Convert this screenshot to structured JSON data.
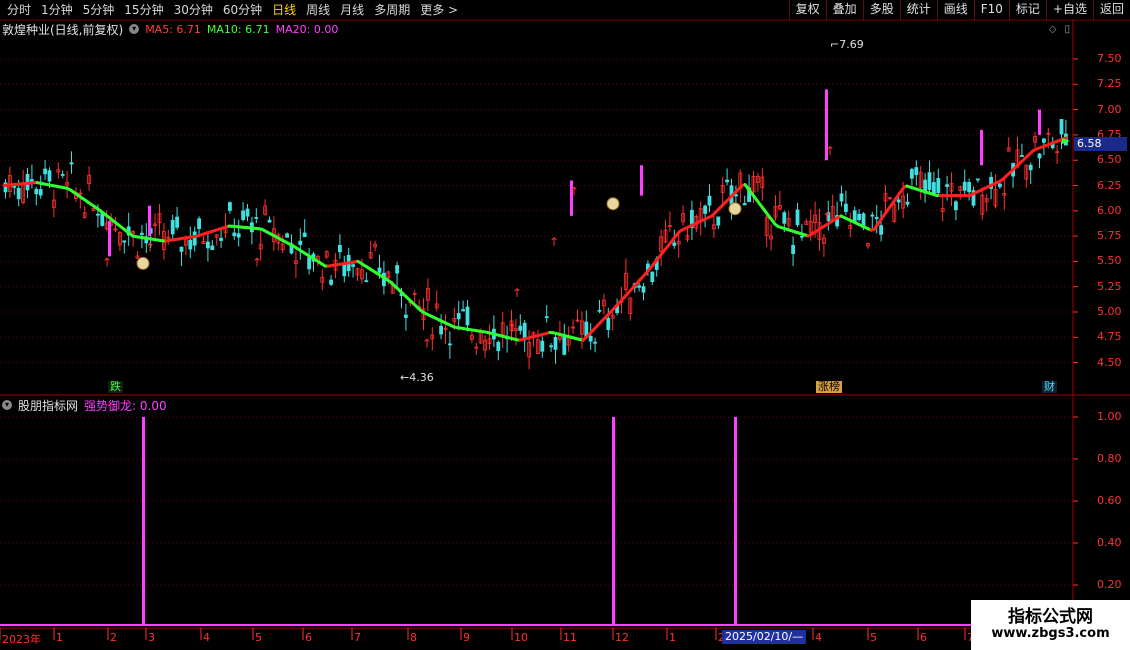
{
  "toolbar": {
    "periods": [
      "分时",
      "1分钟",
      "5分钟",
      "15分钟",
      "30分钟",
      "60分钟",
      "日线",
      "周线",
      "月线",
      "多周期",
      "更多 >"
    ],
    "active_period": "日线",
    "right_buttons": [
      "复权",
      "叠加",
      "多股",
      "统计",
      "画线",
      "F10",
      "标记",
      "+自选",
      "返回"
    ]
  },
  "main_header": {
    "stock_title": "敦煌种业(日线,前复权)",
    "ma5": "MA5: 6.71",
    "ma10": "MA10: 6.71",
    "ma20": "MA20: 0.00"
  },
  "indicator_header": {
    "name": "股朋指标网",
    "var": "强势御龙: 0.00"
  },
  "colors": {
    "axis": "#ff3030",
    "grid": "#6a0000",
    "up": "#ff3030",
    "down": "#40e0e0",
    "ma_up": "#ff2020",
    "ma_down": "#30ff30",
    "signal": "#ff40ff",
    "price_box": "#1a2a8a"
  },
  "price_axis": [
    "7.50",
    "7.25",
    "7.00",
    "6.75",
    "6.50",
    "6.25",
    "6.00",
    "5.75",
    "5.50",
    "5.25",
    "5.00",
    "4.75",
    "4.50"
  ],
  "indicator_axis": [
    "1.00",
    "0.80",
    "0.60",
    "0.40",
    "0.20"
  ],
  "current_price": "6.58",
  "high_mark": "7.69",
  "low_mark": "4.36",
  "events": [
    {
      "label": "跌",
      "color": "#40ff40"
    },
    {
      "label": "涨榜",
      "color": "#ffd700"
    },
    {
      "label": "财",
      "color": "#40e0ff"
    }
  ],
  "date_axis": [
    "2023年",
    "1",
    "2",
    "3",
    "4",
    "5",
    "6",
    "7",
    "8",
    "9",
    "10",
    "11",
    "12",
    "1",
    "2",
    "4",
    "5",
    "6",
    "7"
  ],
  "date_highlight": "2025/02/10/—",
  "watermark": {
    "title": "指标公式网",
    "url": "www.zbgs3.com"
  },
  "chart_data": {
    "type": "line",
    "price_ylim": [
      4.36,
      7.69
    ],
    "ma_line": [
      6.25,
      6.28,
      6.22,
      6.0,
      5.75,
      5.7,
      5.75,
      5.85,
      5.82,
      5.65,
      5.45,
      5.5,
      5.3,
      5.0,
      4.85,
      4.8,
      4.72,
      4.8,
      4.72,
      5.05,
      5.4,
      5.8,
      5.95,
      6.27,
      5.85,
      5.75,
      5.95,
      5.8,
      6.25,
      6.15,
      6.15,
      6.3,
      6.6,
      6.72
    ],
    "indicator": {
      "name": "强势御龙",
      "spikes": [
        1.0,
        1.0,
        1.0
      ],
      "ylim": [
        0,
        1
      ]
    }
  }
}
